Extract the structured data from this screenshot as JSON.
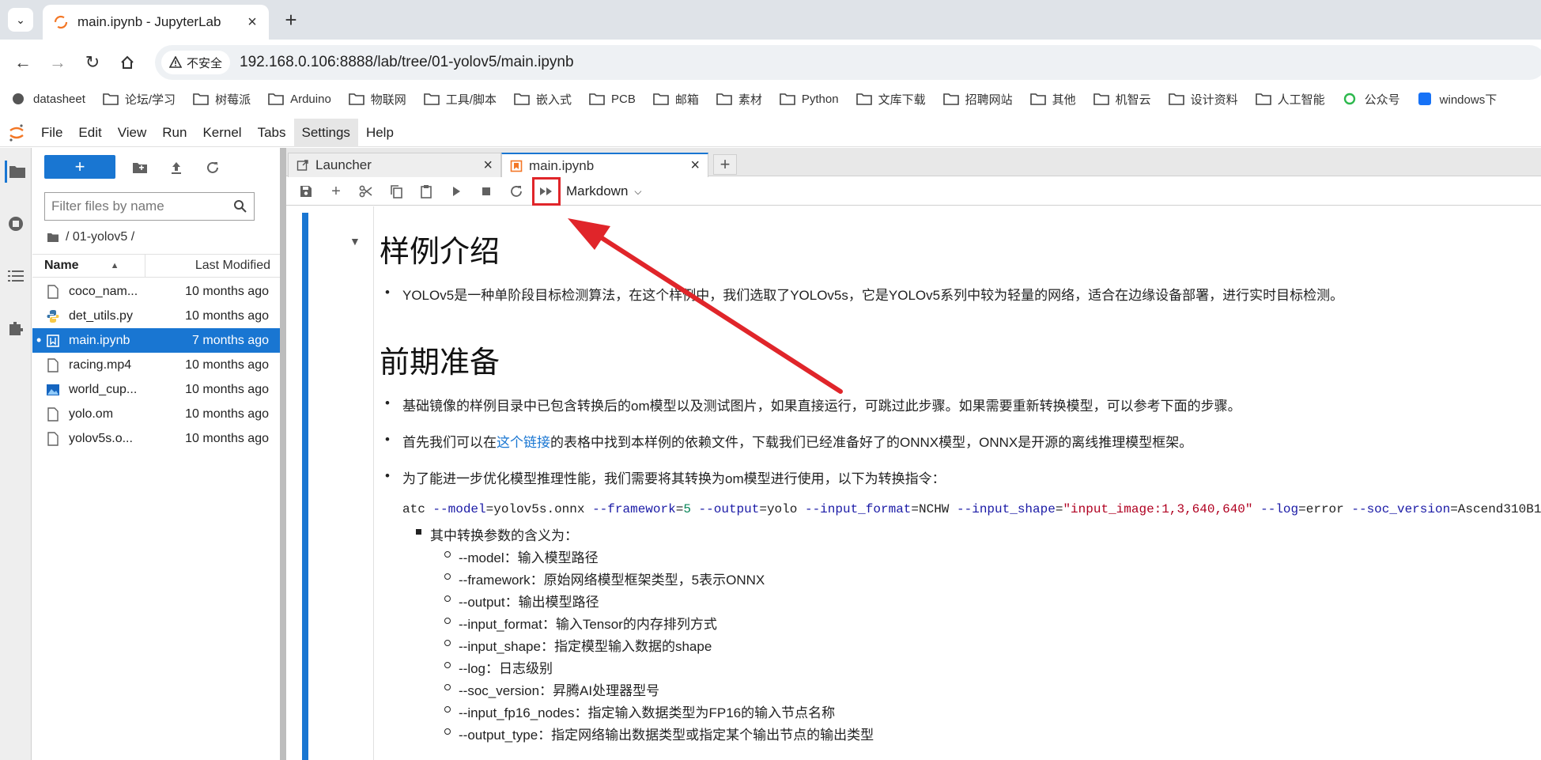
{
  "browser": {
    "tab_title": "main.ipynb - JupyterLab",
    "insecure_label": "不安全",
    "url": "192.168.0.106:8888/lab/tree/01-yolov5/main.ipynb",
    "bookmarks": [
      "datasheet",
      "论坛/学习",
      "树莓派",
      "Arduino",
      "物联网",
      "工具/脚本",
      "嵌入式",
      "PCB",
      "邮箱",
      "素材",
      "Python",
      "文库下载",
      "招聘网站",
      "其他",
      "机智云",
      "设计资料",
      "人工智能",
      "公众号",
      "windows下"
    ]
  },
  "menubar": {
    "items": [
      "File",
      "Edit",
      "View",
      "Run",
      "Kernel",
      "Tabs",
      "Settings",
      "Help"
    ],
    "active": "Settings"
  },
  "filebrowser": {
    "new_label": "+",
    "filter_placeholder": "Filter files by name",
    "breadcrumb": "/ 01-yolov5 /",
    "col_name": "Name",
    "col_modified": "Last Modified",
    "files": [
      {
        "name": "coco_nam...",
        "modified": "10 months ago",
        "icon": "file-icon"
      },
      {
        "name": "det_utils.py",
        "modified": "10 months ago",
        "icon": "python-icon"
      },
      {
        "name": "main.ipynb",
        "modified": "7 months ago",
        "icon": "notebook-icon",
        "selected": true
      },
      {
        "name": "racing.mp4",
        "modified": "10 months ago",
        "icon": "file-icon"
      },
      {
        "name": "world_cup...",
        "modified": "10 months ago",
        "icon": "image-icon"
      },
      {
        "name": "yolo.om",
        "modified": "10 months ago",
        "icon": "file-icon"
      },
      {
        "name": "yolov5s.o...",
        "modified": "10 months ago",
        "icon": "file-icon"
      }
    ]
  },
  "doctabs": [
    {
      "label": "Launcher",
      "icon": "launcher-icon"
    },
    {
      "label": "main.ipynb",
      "icon": "notebook-icon"
    }
  ],
  "toolbar": {
    "cell_type": "Markdown"
  },
  "notebook": {
    "h1_intro": "样例介绍",
    "intro_text": "YOLOv5是一种单阶段目标检测算法，在这个样例中，我们选取了YOLOv5s，它是YOLOv5系列中较为轻量的网络，适合在边缘设备部署，进行实时目标检测。",
    "h1_prep": "前期准备",
    "prep1": "基础镜像的样例目录中已包含转换后的om模型以及测试图片，如果直接运行，可跳过此步骤。如果需要重新转换模型，可以参考下面的步骤。",
    "prep2_before": "首先我们可以在",
    "prep2_link": "这个链接",
    "prep2_after": "的表格中找到本样例的依赖文件，下载我们已经准备好了的ONNX模型，ONNX是开源的离线推理模型框架。",
    "prep3": "为了能进一步优化模型推理性能，我们需要将其转换为om模型进行使用，以下为转换指令：",
    "cmd": {
      "atc": "atc",
      "model_flag": "--model",
      "model_val": "yolov5s.onnx",
      "fw_flag": "--framework",
      "fw_val": "5",
      "out_flag": "--output",
      "out_val": "yolo",
      "fmt_flag": "--input_format",
      "fmt_val": "NCHW",
      "shape_flag": "--input_shape",
      "shape_val": "\"input_image:1,3,640,640\"",
      "log_flag": "--log",
      "log_val": "error",
      "soc_flag": "--soc_version",
      "soc_val": "Ascend310B1"
    },
    "params_heading": "其中转换参数的含义为：",
    "params": [
      "--model：输入模型路径",
      "--framework：原始网络模型框架类型，5表示ONNX",
      "--output：输出模型路径",
      "--input_format：输入Tensor的内存排列方式",
      "--input_shape：指定模型输入数据的shape",
      "--log：日志级别",
      "--soc_version：昇腾AI处理器型号",
      "--input_fp16_nodes：指定输入数据类型为FP16的输入节点名称",
      "--output_type：指定网络输出数据类型或指定某个输出节点的输出类型"
    ]
  },
  "colors": {
    "accent": "#1976d2",
    "annotation": "#e0252a",
    "jupyter_orange": "#f37726"
  }
}
